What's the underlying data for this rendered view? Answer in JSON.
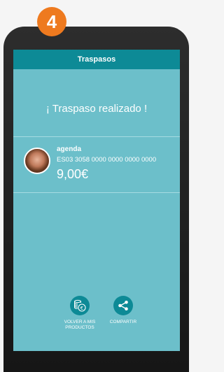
{
  "step": {
    "number": "4"
  },
  "header": {
    "title": "Traspasos"
  },
  "status": {
    "message": "¡ Traspaso realizado !"
  },
  "transfer": {
    "account_name": "agenda",
    "iban": "ES03 3058 0000 0000 0000 0000",
    "amount": "9,00€"
  },
  "actions": {
    "back": {
      "label_line1": "VOLVER A MIS",
      "label_line2": "PRODUCTOS",
      "icon": "coins-euro-icon"
    },
    "share": {
      "label": "COMPARTIR",
      "icon": "share-icon"
    }
  },
  "colors": {
    "header": "#0d8a96",
    "screen": "#6cbfca",
    "badge": "#ee7a1f"
  }
}
